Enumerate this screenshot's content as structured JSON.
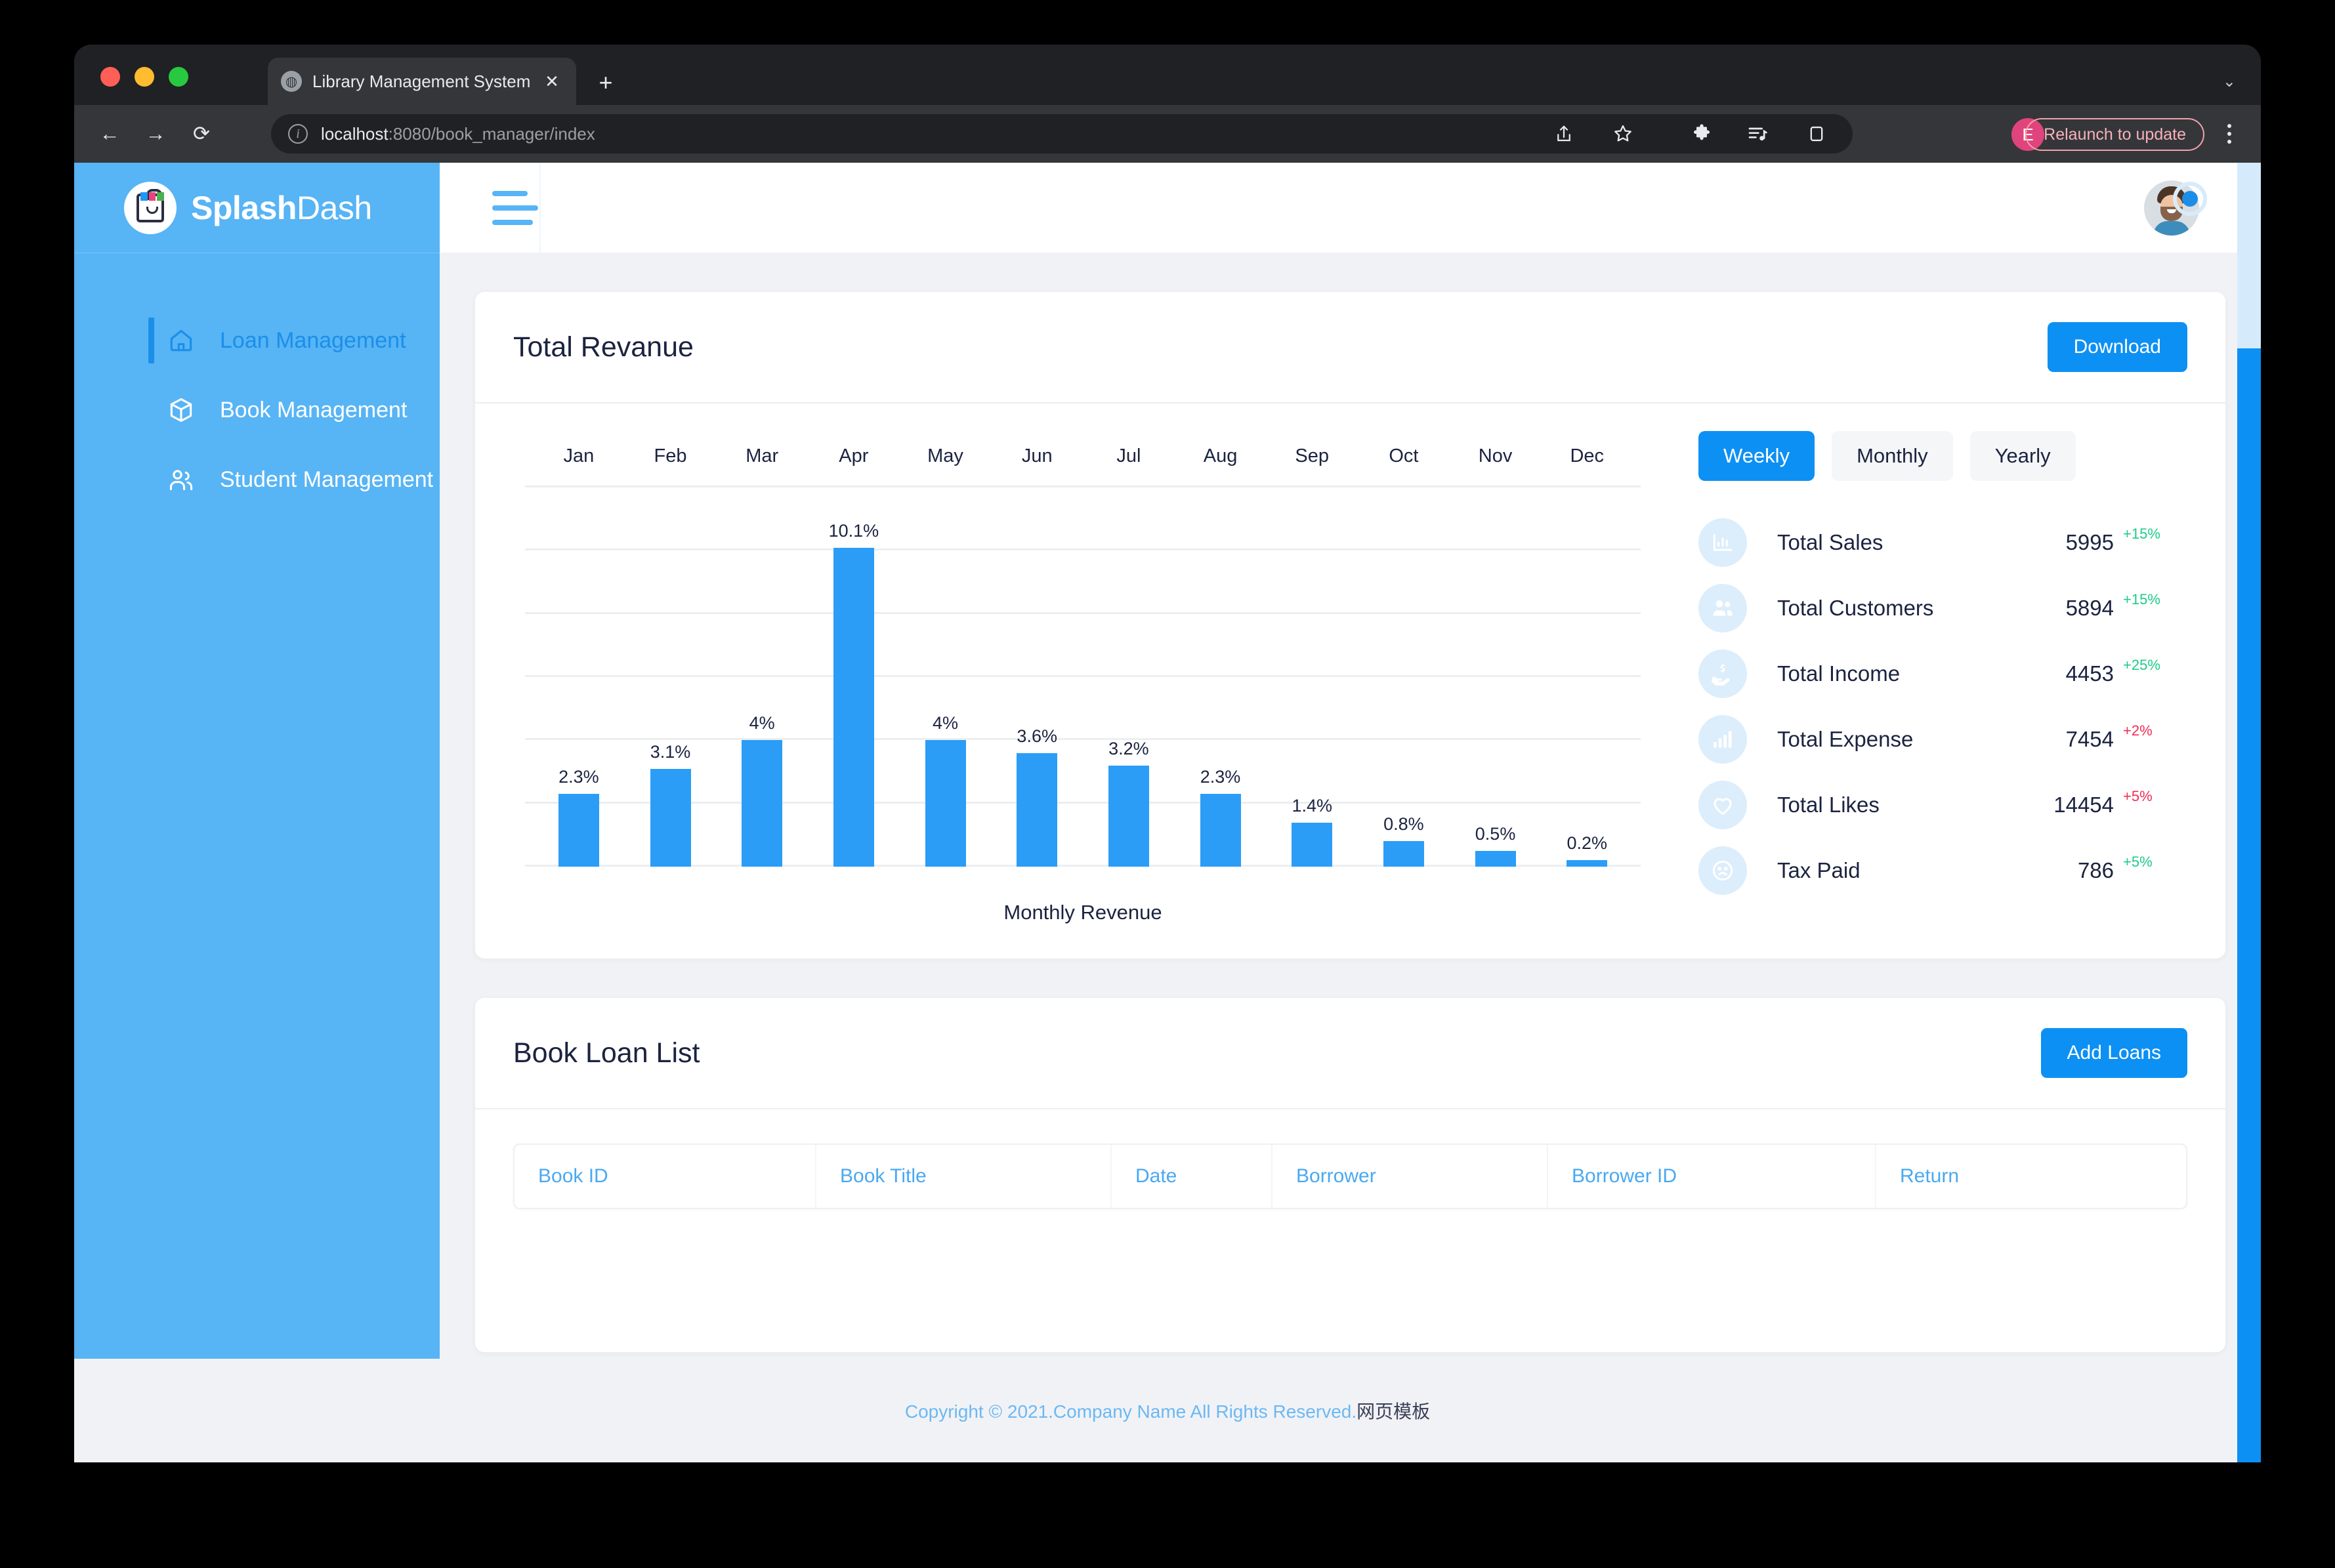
{
  "browser": {
    "tab": {
      "title": "Library Management System",
      "favicon": "globe-icon",
      "close": "✕"
    },
    "new_tab": "+",
    "tab_list_chevron": "⌄",
    "back": "←",
    "forward": "→",
    "reload": "⟳",
    "url_bold": "localhost",
    "url_rest": ":8080/book_manager/index",
    "relaunch_label": "Relaunch to update",
    "profile_initial": "E"
  },
  "sidebar": {
    "logo_bold": "Splash",
    "logo_light": "Dash",
    "items": [
      {
        "label": "Loan Management",
        "icon": "home-icon",
        "active": true
      },
      {
        "label": "Book Management",
        "icon": "box-icon",
        "active": false
      },
      {
        "label": "Student Management",
        "icon": "users-icon",
        "active": false
      }
    ]
  },
  "revenue_card": {
    "title": "Total Revanue",
    "download_label": "Download",
    "tabs": [
      {
        "label": "Weekly",
        "active": true
      },
      {
        "label": "Monthly",
        "active": false
      },
      {
        "label": "Yearly",
        "active": false
      }
    ],
    "stats": [
      {
        "icon": "bar-chart-outline-icon",
        "name": "Total Sales",
        "value": "5995",
        "delta": "+15%",
        "direction": "up"
      },
      {
        "icon": "users-solid-icon",
        "name": "Total Customers",
        "value": "5894",
        "delta": "+15%",
        "direction": "up"
      },
      {
        "icon": "hand-dollar-icon",
        "name": "Total Income",
        "value": "4453",
        "delta": "+25%",
        "direction": "up"
      },
      {
        "icon": "bar-chart-solid-icon",
        "name": "Total Expense",
        "value": "7454",
        "delta": "+2%",
        "direction": "down"
      },
      {
        "icon": "heart-icon",
        "name": "Total Likes",
        "value": "14454",
        "delta": "+5%",
        "direction": "down"
      },
      {
        "icon": "sad-face-icon",
        "name": "Tax Paid",
        "value": "786",
        "delta": "+5%",
        "direction": "up"
      }
    ]
  },
  "chart_data": {
    "type": "bar",
    "title": "Total Revanue",
    "xlabel": "Monthly Revenue",
    "ylabel": "",
    "categories": [
      "Jan",
      "Feb",
      "Mar",
      "Apr",
      "May",
      "Jun",
      "Jul",
      "Aug",
      "Sep",
      "Oct",
      "Nov",
      "Dec"
    ],
    "values": [
      2.3,
      3.1,
      4,
      10.1,
      4,
      3.6,
      3.2,
      2.3,
      1.4,
      0.8,
      0.5,
      0.2
    ],
    "value_labels": [
      "2.3%",
      "3.1%",
      "4%",
      "10.1%",
      "4%",
      "3.6%",
      "3.2%",
      "2.3%",
      "1.4%",
      "0.8%",
      "0.5%",
      "0.2%"
    ],
    "unit": "%",
    "ylim": [
      0,
      12
    ],
    "gridlines": [
      0,
      2,
      4,
      6,
      8,
      10,
      12
    ],
    "grid": true,
    "legend": "none",
    "bar_color": "#2b9df7",
    "x_axis_position": "top"
  },
  "loan_card": {
    "title": "Book Loan List",
    "add_label": "Add Loans",
    "columns": [
      "Book ID",
      "Book Title",
      "Date",
      "Borrower",
      "Borrower ID",
      "Return"
    ],
    "rows": []
  },
  "footer": {
    "text": "Copyright © 2021.Company Name All Rights Reserved.",
    "cn": "网页模板"
  }
}
